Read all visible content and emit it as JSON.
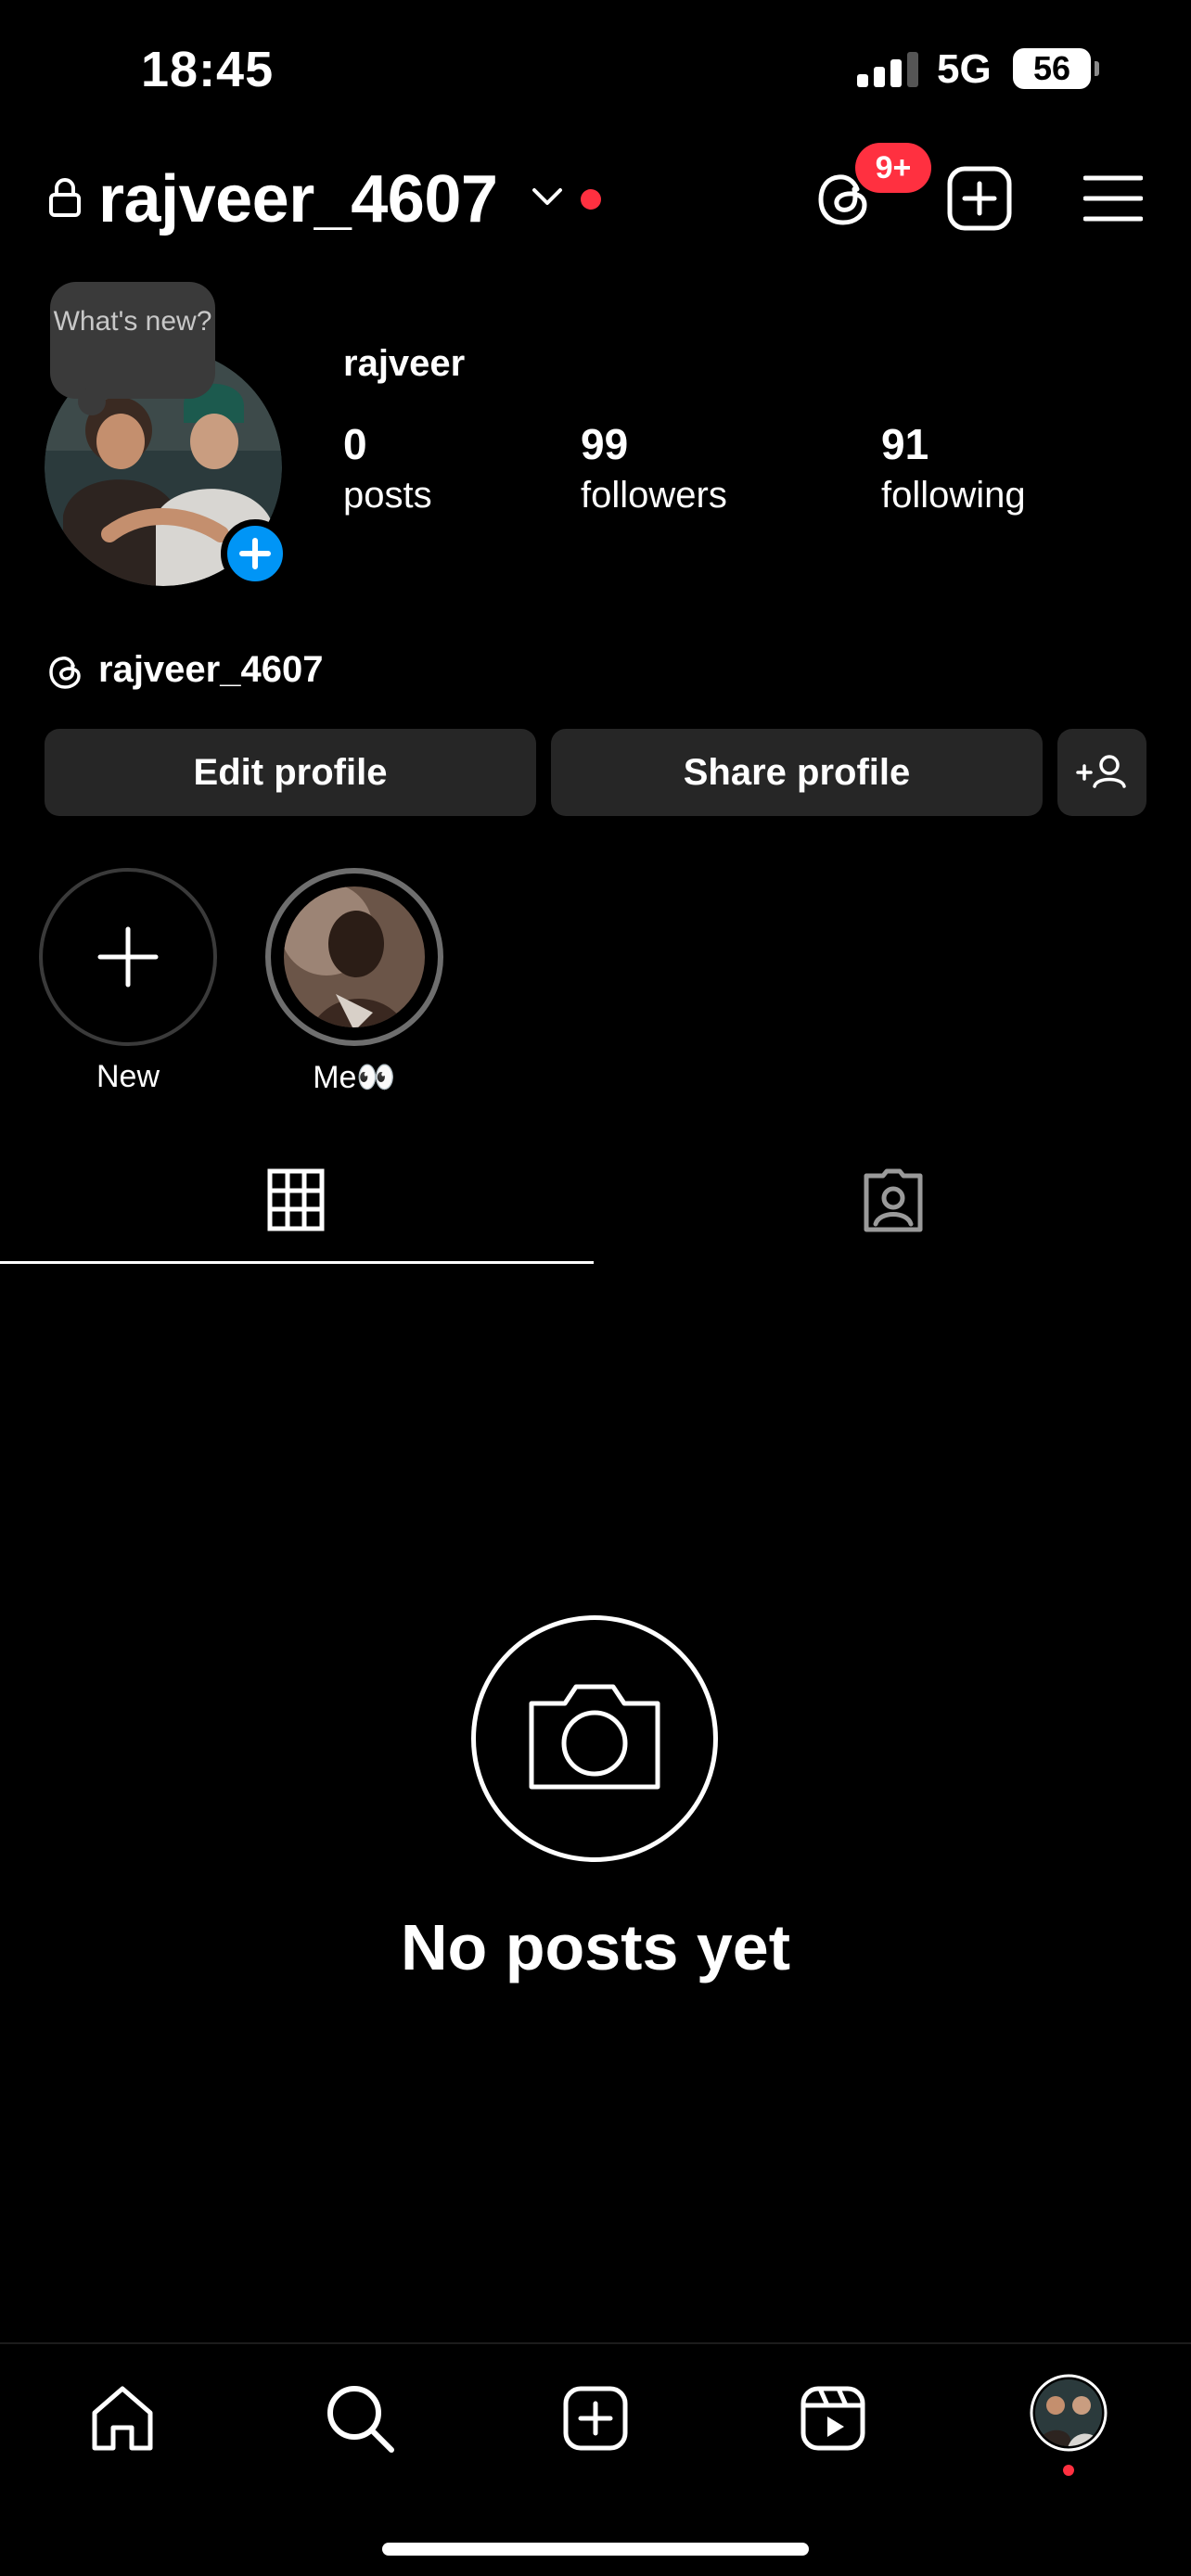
{
  "status_bar": {
    "time": "18:45",
    "network": "5G",
    "battery": "56"
  },
  "header": {
    "username": "rajveer_4607",
    "notification_badge": "9+"
  },
  "profile": {
    "whats_new": "What's new?",
    "display_name": "rajveer",
    "stats": [
      {
        "value": "0",
        "label": "posts"
      },
      {
        "value": "99",
        "label": "followers"
      },
      {
        "value": "91",
        "label": "following"
      }
    ],
    "threads_handle": "rajveer_4607"
  },
  "actions": {
    "edit_label": "Edit profile",
    "share_label": "Share profile"
  },
  "highlights": [
    {
      "label": "New"
    },
    {
      "label": "Me👀"
    }
  ],
  "tabs": [
    "grid-icon",
    "tagged-icon"
  ],
  "empty_state": {
    "text": "No posts yet"
  },
  "bottom_nav": [
    "home-icon",
    "search-icon",
    "create-icon",
    "reels-icon",
    "profile-avatar"
  ],
  "colors": {
    "accent": "#0095f6",
    "badge": "#ff3040",
    "button_bg": "#262626"
  }
}
